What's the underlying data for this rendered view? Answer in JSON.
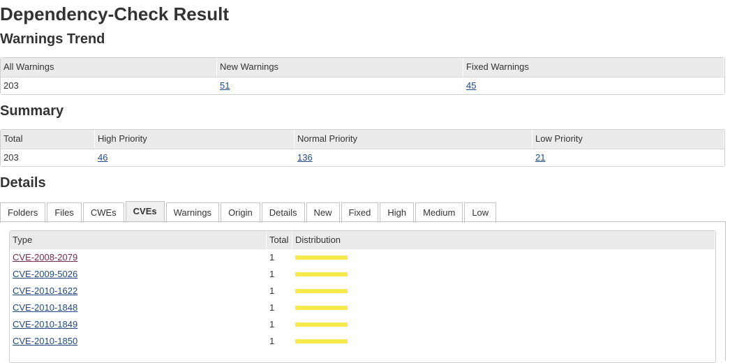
{
  "page_title": "Dependency-Check Result",
  "trend": {
    "heading": "Warnings Trend",
    "headers": [
      "All Warnings",
      "New Warnings",
      "Fixed Warnings"
    ],
    "values": [
      "203",
      "51",
      "45"
    ]
  },
  "summary": {
    "heading": "Summary",
    "headers": [
      "Total",
      "High Priority",
      "Normal Priority",
      "Low Priority"
    ],
    "values": [
      "203",
      "46",
      "136",
      "21"
    ]
  },
  "details": {
    "heading": "Details",
    "tabs": [
      "Folders",
      "Files",
      "CWEs",
      "CVEs",
      "Warnings",
      "Origin",
      "Details",
      "New",
      "Fixed",
      "High",
      "Medium",
      "Low"
    ],
    "active_tab": "CVEs",
    "table": {
      "headers": [
        "Type",
        "Total",
        "Distribution"
      ],
      "rows": [
        {
          "type": "CVE-2008-2079",
          "total": "1",
          "distribution": 1
        },
        {
          "type": "CVE-2009-5026",
          "total": "1",
          "distribution": 1
        },
        {
          "type": "CVE-2010-1622",
          "total": "1",
          "distribution": 1
        },
        {
          "type": "CVE-2010-1848",
          "total": "1",
          "distribution": 1
        },
        {
          "type": "CVE-2010-1849",
          "total": "1",
          "distribution": 1
        },
        {
          "type": "CVE-2010-1850",
          "total": "1",
          "distribution": 1
        }
      ]
    }
  },
  "colors": {
    "header_bg": "#ebebeb",
    "link": "#204a87",
    "visited_link": "#7a2a4a",
    "distribution_bar": "#f5e94b"
  }
}
